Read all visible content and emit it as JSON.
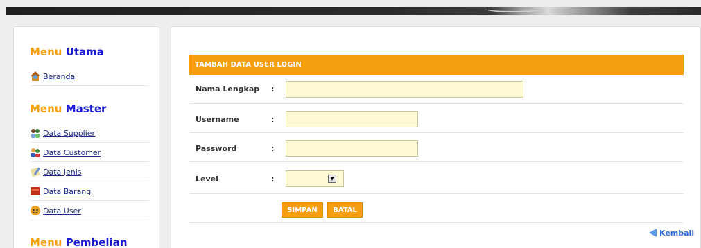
{
  "sidebar": {
    "menus": [
      {
        "w1": "Menu",
        "w2": "Utama",
        "items": [
          {
            "label": "Beranda",
            "icon": "home-icon"
          }
        ]
      },
      {
        "w1": "Menu",
        "w2": "Master",
        "items": [
          {
            "label": "Data Supplier",
            "icon": "supplier-icon"
          },
          {
            "label": "Data Customer",
            "icon": "customer-icon"
          },
          {
            "label": "Data Jenis",
            "icon": "jenis-icon"
          },
          {
            "label": "Data Barang",
            "icon": "barang-icon"
          },
          {
            "label": "Data User",
            "icon": "user-icon"
          }
        ]
      },
      {
        "w1": "Menu",
        "w2": "Pembelian",
        "items": []
      }
    ]
  },
  "form": {
    "header": "TAMBAH DATA USER LOGIN",
    "fields": [
      {
        "label": "Nama Lengkap",
        "colon": ":",
        "value": ""
      },
      {
        "label": "Username",
        "colon": ":",
        "value": ""
      },
      {
        "label": "Password",
        "colon": ":",
        "value": ""
      },
      {
        "label": "Level",
        "colon": ":",
        "value": ""
      }
    ],
    "save_label": "SIMPAN",
    "cancel_label": "BATAL",
    "back_label": "Kembali"
  },
  "colors": {
    "accent": "#f59f0e",
    "menu_word1": "#f5a00f",
    "menu_word2": "#1a1ad4",
    "input_bg": "#fcf9d4",
    "link": "#1c2a8a"
  }
}
